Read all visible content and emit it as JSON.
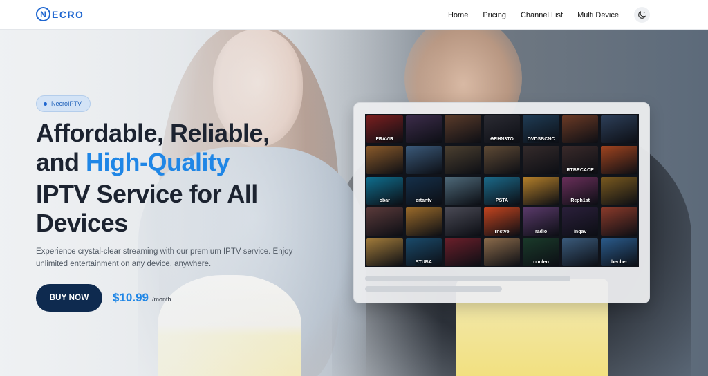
{
  "header": {
    "logo_mark": "N",
    "logo_text": "ECRO",
    "nav": [
      "Home",
      "Pricing",
      "Channel List",
      "Multi Device"
    ]
  },
  "hero": {
    "badge": "NecroIPTV",
    "headline_line1": "Affordable, Reliable,",
    "headline_line2_prefix": "and ",
    "headline_line2_accent": "High-Quality",
    "headline_line3": "IPTV Service for All",
    "headline_line4": "Devices",
    "description": "Experience crystal-clear streaming with our premium IPTV service. Enjoy unlimited entertainment on any device, anywhere.",
    "buy_label": "BUY NOW",
    "price": "$10.99",
    "price_unit": "/month"
  },
  "tv": {
    "tiles": [
      {
        "label": "FRAVIR",
        "color": "#7a1f1f"
      },
      {
        "label": "",
        "color": "#3c2c4a"
      },
      {
        "label": "",
        "color": "#5a3b2a"
      },
      {
        "label": "ӘRHN3TO",
        "color": "#2b2b33"
      },
      {
        "label": "DVDSBCNC",
        "color": "#1f3c55"
      },
      {
        "label": "",
        "color": "#6b3a25"
      },
      {
        "label": "",
        "color": "#2d3f59"
      },
      {
        "label": "",
        "color": "#8a5a2a"
      },
      {
        "label": "",
        "color": "#3b5a7a"
      },
      {
        "label": "",
        "color": "#4c4030"
      },
      {
        "label": "",
        "color": "#5f4a35"
      },
      {
        "label": "",
        "color": "#352b2b"
      },
      {
        "label": "RTBRCACE",
        "color": "#3a2a2a"
      },
      {
        "label": "",
        "color": "#a0441f"
      },
      {
        "label": "obar",
        "color": "#0f6f8f"
      },
      {
        "label": "ertantv",
        "color": "#15304a"
      },
      {
        "label": "",
        "color": "#4f6a7a"
      },
      {
        "label": "PSTA",
        "color": "#1b6a8a"
      },
      {
        "label": "",
        "color": "#b5802a"
      },
      {
        "label": "Reph1st",
        "color": "#6a2f5a"
      },
      {
        "label": "",
        "color": "#7a5a1f"
      },
      {
        "label": "",
        "color": "#5a3a3a"
      },
      {
        "label": "",
        "color": "#9a6a2a"
      },
      {
        "label": "",
        "color": "#4a4a55"
      },
      {
        "label": "rnctve",
        "color": "#c2441f"
      },
      {
        "label": "radio",
        "color": "#5a3a6a"
      },
      {
        "label": "inqav",
        "color": "#2a1f3a"
      },
      {
        "label": "",
        "color": "#8a3a2a"
      },
      {
        "label": "",
        "color": "#a07a3a"
      },
      {
        "label": "STUBA",
        "color": "#1a4a6a"
      },
      {
        "label": "",
        "color": "#6a1f2a"
      },
      {
        "label": "",
        "color": "#8a6a4a"
      },
      {
        "label": "cooleo",
        "color": "#1a3a2a"
      },
      {
        "label": "",
        "color": "#3a5a7a"
      },
      {
        "label": "beober",
        "color": "#2a5a8a"
      }
    ]
  },
  "colors": {
    "brand": "#1e66d0",
    "accent": "#1f86e6",
    "button_dark": "#0e2a4f"
  }
}
